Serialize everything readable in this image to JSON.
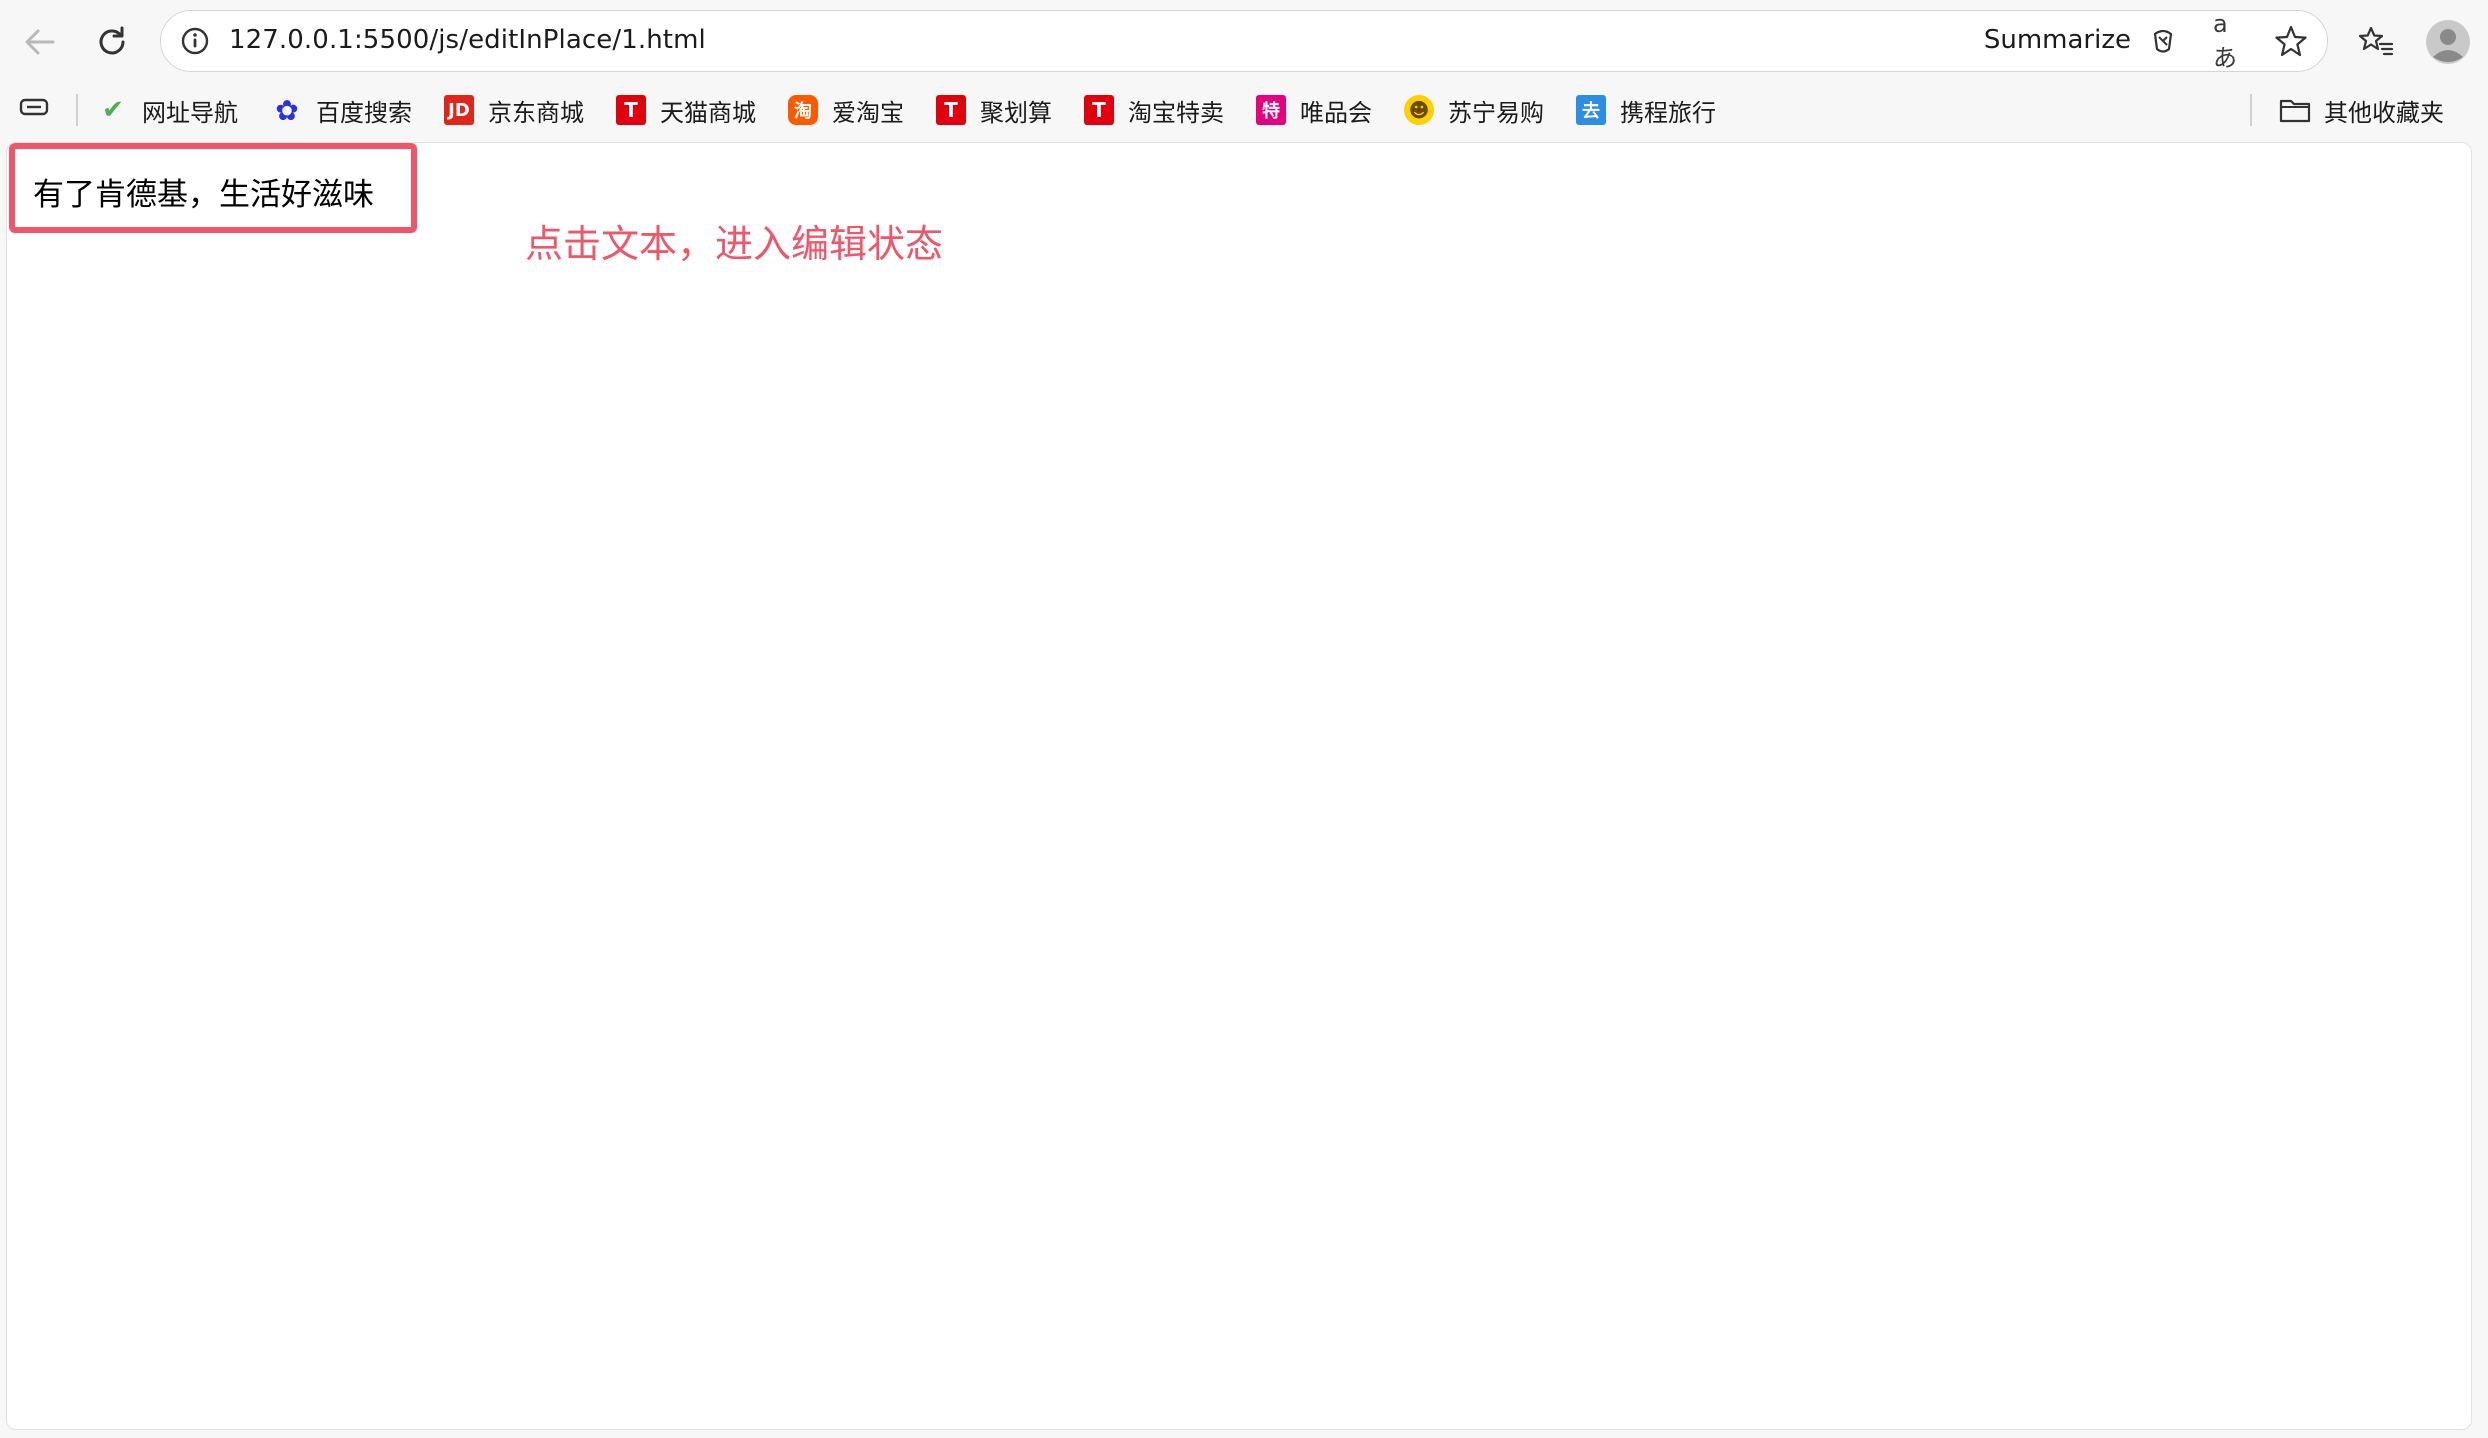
{
  "browser": {
    "url": "127.0.0.1:5500/js/editInPlace/1.html",
    "summarize_label": "Summarize",
    "translate_label": "aあ",
    "icons": [
      "back-icon",
      "refresh-icon",
      "site-info-icon",
      "copilot-icon",
      "translate-icon",
      "star-icon",
      "favorites-icon",
      "profile-icon"
    ]
  },
  "bookmarks": {
    "items": [
      {
        "label": "网址导航",
        "icon": "hao-icon",
        "color": "#4caf50",
        "glyph": "✔"
      },
      {
        "label": "百度搜索",
        "icon": "baidu-paw-icon",
        "color": "#2932e1",
        "glyph": "✿"
      },
      {
        "label": "京东商城",
        "icon": "jd-icon",
        "color": "#e1251b",
        "glyph": "JD"
      },
      {
        "label": "天猫商城",
        "icon": "tmall-icon",
        "color": "#e1000f",
        "glyph": "T"
      },
      {
        "label": "爱淘宝",
        "icon": "taobao-icon",
        "color": "#ff5a00",
        "glyph": "淘"
      },
      {
        "label": "聚划算",
        "icon": "juhuasuan-icon",
        "color": "#e1000f",
        "glyph": "T"
      },
      {
        "label": "淘宝特卖",
        "icon": "taobao-temai-icon",
        "color": "#e1000f",
        "glyph": "T"
      },
      {
        "label": "唯品会",
        "icon": "vip-icon",
        "color": "#e4007f",
        "glyph": "特"
      },
      {
        "label": "苏宁易购",
        "icon": "suning-icon",
        "color": "#ffd000",
        "glyph": "☻"
      },
      {
        "label": "携程旅行",
        "icon": "ctrip-icon",
        "color": "#2d8de0",
        "glyph": "去"
      }
    ],
    "other_folder_label": "其他收藏夹"
  },
  "page": {
    "editable_text": "有了肯德基，生活好滋味",
    "annotation": "点击文本，进入编辑状态",
    "accent_color": "#f0566a"
  }
}
